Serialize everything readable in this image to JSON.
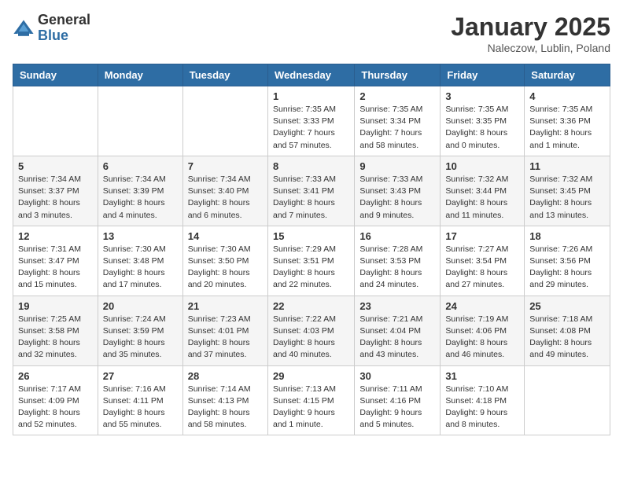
{
  "header": {
    "logo_general": "General",
    "logo_blue": "Blue",
    "month_title": "January 2025",
    "location": "Naleczow, Lublin, Poland"
  },
  "weekdays": [
    "Sunday",
    "Monday",
    "Tuesday",
    "Wednesday",
    "Thursday",
    "Friday",
    "Saturday"
  ],
  "weeks": [
    [
      {
        "day": "",
        "info": ""
      },
      {
        "day": "",
        "info": ""
      },
      {
        "day": "",
        "info": ""
      },
      {
        "day": "1",
        "info": "Sunrise: 7:35 AM\nSunset: 3:33 PM\nDaylight: 7 hours and 57 minutes."
      },
      {
        "day": "2",
        "info": "Sunrise: 7:35 AM\nSunset: 3:34 PM\nDaylight: 7 hours and 58 minutes."
      },
      {
        "day": "3",
        "info": "Sunrise: 7:35 AM\nSunset: 3:35 PM\nDaylight: 8 hours and 0 minutes."
      },
      {
        "day": "4",
        "info": "Sunrise: 7:35 AM\nSunset: 3:36 PM\nDaylight: 8 hours and 1 minute."
      }
    ],
    [
      {
        "day": "5",
        "info": "Sunrise: 7:34 AM\nSunset: 3:37 PM\nDaylight: 8 hours and 3 minutes."
      },
      {
        "day": "6",
        "info": "Sunrise: 7:34 AM\nSunset: 3:39 PM\nDaylight: 8 hours and 4 minutes."
      },
      {
        "day": "7",
        "info": "Sunrise: 7:34 AM\nSunset: 3:40 PM\nDaylight: 8 hours and 6 minutes."
      },
      {
        "day": "8",
        "info": "Sunrise: 7:33 AM\nSunset: 3:41 PM\nDaylight: 8 hours and 7 minutes."
      },
      {
        "day": "9",
        "info": "Sunrise: 7:33 AM\nSunset: 3:43 PM\nDaylight: 8 hours and 9 minutes."
      },
      {
        "day": "10",
        "info": "Sunrise: 7:32 AM\nSunset: 3:44 PM\nDaylight: 8 hours and 11 minutes."
      },
      {
        "day": "11",
        "info": "Sunrise: 7:32 AM\nSunset: 3:45 PM\nDaylight: 8 hours and 13 minutes."
      }
    ],
    [
      {
        "day": "12",
        "info": "Sunrise: 7:31 AM\nSunset: 3:47 PM\nDaylight: 8 hours and 15 minutes."
      },
      {
        "day": "13",
        "info": "Sunrise: 7:30 AM\nSunset: 3:48 PM\nDaylight: 8 hours and 17 minutes."
      },
      {
        "day": "14",
        "info": "Sunrise: 7:30 AM\nSunset: 3:50 PM\nDaylight: 8 hours and 20 minutes."
      },
      {
        "day": "15",
        "info": "Sunrise: 7:29 AM\nSunset: 3:51 PM\nDaylight: 8 hours and 22 minutes."
      },
      {
        "day": "16",
        "info": "Sunrise: 7:28 AM\nSunset: 3:53 PM\nDaylight: 8 hours and 24 minutes."
      },
      {
        "day": "17",
        "info": "Sunrise: 7:27 AM\nSunset: 3:54 PM\nDaylight: 8 hours and 27 minutes."
      },
      {
        "day": "18",
        "info": "Sunrise: 7:26 AM\nSunset: 3:56 PM\nDaylight: 8 hours and 29 minutes."
      }
    ],
    [
      {
        "day": "19",
        "info": "Sunrise: 7:25 AM\nSunset: 3:58 PM\nDaylight: 8 hours and 32 minutes."
      },
      {
        "day": "20",
        "info": "Sunrise: 7:24 AM\nSunset: 3:59 PM\nDaylight: 8 hours and 35 minutes."
      },
      {
        "day": "21",
        "info": "Sunrise: 7:23 AM\nSunset: 4:01 PM\nDaylight: 8 hours and 37 minutes."
      },
      {
        "day": "22",
        "info": "Sunrise: 7:22 AM\nSunset: 4:03 PM\nDaylight: 8 hours and 40 minutes."
      },
      {
        "day": "23",
        "info": "Sunrise: 7:21 AM\nSunset: 4:04 PM\nDaylight: 8 hours and 43 minutes."
      },
      {
        "day": "24",
        "info": "Sunrise: 7:19 AM\nSunset: 4:06 PM\nDaylight: 8 hours and 46 minutes."
      },
      {
        "day": "25",
        "info": "Sunrise: 7:18 AM\nSunset: 4:08 PM\nDaylight: 8 hours and 49 minutes."
      }
    ],
    [
      {
        "day": "26",
        "info": "Sunrise: 7:17 AM\nSunset: 4:09 PM\nDaylight: 8 hours and 52 minutes."
      },
      {
        "day": "27",
        "info": "Sunrise: 7:16 AM\nSunset: 4:11 PM\nDaylight: 8 hours and 55 minutes."
      },
      {
        "day": "28",
        "info": "Sunrise: 7:14 AM\nSunset: 4:13 PM\nDaylight: 8 hours and 58 minutes."
      },
      {
        "day": "29",
        "info": "Sunrise: 7:13 AM\nSunset: 4:15 PM\nDaylight: 9 hours and 1 minute."
      },
      {
        "day": "30",
        "info": "Sunrise: 7:11 AM\nSunset: 4:16 PM\nDaylight: 9 hours and 5 minutes."
      },
      {
        "day": "31",
        "info": "Sunrise: 7:10 AM\nSunset: 4:18 PM\nDaylight: 9 hours and 8 minutes."
      },
      {
        "day": "",
        "info": ""
      }
    ]
  ]
}
